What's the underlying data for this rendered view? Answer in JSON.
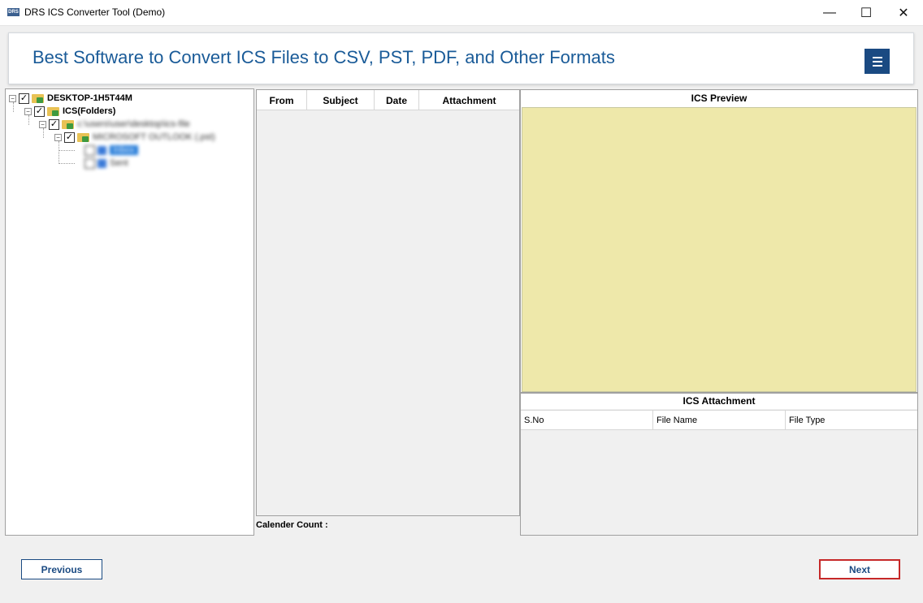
{
  "window": {
    "app_icon_text": "DRS",
    "title": "DRS ICS Converter Tool (Demo)",
    "minimize_glyph": "—",
    "maximize_glyph": "☐",
    "close_glyph": "✕"
  },
  "banner": {
    "title": "Best Software to Convert ICS Files to CSV, PST, PDF, and Other Formats",
    "menu_icon": "hamburger-menu-icon"
  },
  "tree": {
    "root_label": "DESKTOP-1H5T44M",
    "folder_label": "ICS(Folders)",
    "path_label": "c:\\users\\user\\desktop\\ics-file",
    "pst_label": "MICROSOFT OUTLOOK (.pst)",
    "selected_item_label": "Inbox",
    "sent_item_label": "Sent",
    "check_glyph": "✓",
    "collapse_glyph": "−"
  },
  "list": {
    "columns": [
      "From",
      "Subject",
      "Date",
      "Attachment"
    ],
    "calendar_count_label": "Calender Count :"
  },
  "preview": {
    "title": "ICS Preview"
  },
  "attachment": {
    "title": "ICS Attachment",
    "columns": [
      "S.No",
      "File Name",
      "File Type"
    ]
  },
  "buttons": {
    "previous": "Previous",
    "next": "Next"
  },
  "colors": {
    "banner_text": "#1a5b98",
    "menu_button": "#1a4a82",
    "preview_background": "#eee8aa",
    "next_border": "#c62828"
  }
}
